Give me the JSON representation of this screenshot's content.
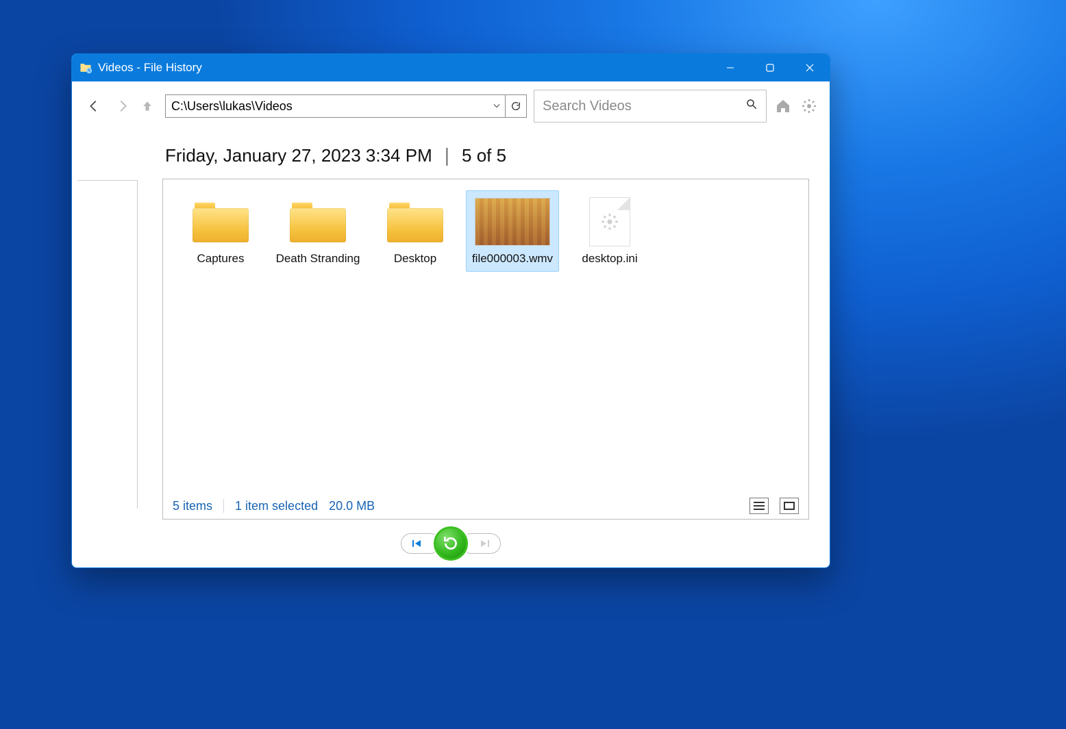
{
  "window": {
    "title": "Videos - File History"
  },
  "toolbar": {
    "path": "C:\\Users\\lukas\\Videos",
    "search_placeholder": "Search Videos"
  },
  "snapshot": {
    "timestamp": "Friday, January 27, 2023 3:34 PM",
    "position": "5 of 5"
  },
  "items": [
    {
      "name": "Captures",
      "kind": "folder",
      "selected": false
    },
    {
      "name": "Death Stranding",
      "kind": "folder",
      "selected": false
    },
    {
      "name": "Desktop",
      "kind": "folder",
      "selected": false
    },
    {
      "name": "file000003.wmv",
      "kind": "video",
      "selected": true
    },
    {
      "name": "desktop.ini",
      "kind": "ini",
      "selected": false
    }
  ],
  "status": {
    "item_count": "5 items",
    "selection": "1 item selected",
    "size": "20.0 MB"
  },
  "nav": {
    "prev_enabled": true,
    "next_enabled": false
  }
}
